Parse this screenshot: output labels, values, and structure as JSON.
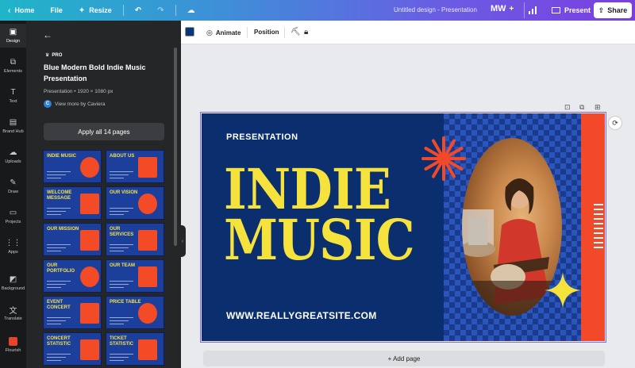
{
  "topbar": {
    "home": "Home",
    "file": "File",
    "resize": "Resize",
    "doc_title": "Untitled design - Presentation",
    "user_initials": "MW",
    "present": "Present",
    "share": "Share"
  },
  "rail": {
    "items": [
      {
        "label": "Design",
        "icon": "design-icon"
      },
      {
        "label": "Elements",
        "icon": "elements-icon"
      },
      {
        "label": "Text",
        "icon": "text-icon"
      },
      {
        "label": "Brand Hub",
        "icon": "brand-hub-icon"
      },
      {
        "label": "Uploads",
        "icon": "uploads-icon"
      },
      {
        "label": "Draw",
        "icon": "draw-icon"
      },
      {
        "label": "Projects",
        "icon": "projects-icon"
      },
      {
        "label": "Apps",
        "icon": "apps-icon"
      },
      {
        "label": "Background",
        "icon": "background-icon"
      },
      {
        "label": "Translate",
        "icon": "translate-icon"
      },
      {
        "label": "Flourish",
        "icon": "flourish-icon"
      }
    ]
  },
  "panel": {
    "badge": "PRO",
    "title": "Blue Modern Bold Indie Music Presentation",
    "meta": "Presentation • 1920 × 1080 px",
    "author": "View more by Caviera",
    "apply_button": "Apply all 14 pages",
    "thumbnails": [
      {
        "title": "INDIE MUSIC"
      },
      {
        "title": "ABOUT US"
      },
      {
        "title": "WELCOME MESSAGE"
      },
      {
        "title": "OUR VISION"
      },
      {
        "title": "OUR MISSION"
      },
      {
        "title": "OUR SERVICES"
      },
      {
        "title": "OUR PORTFOLIO"
      },
      {
        "title": "OUR TEAM"
      },
      {
        "title": "EVENT CONCERT"
      },
      {
        "title": "PRICE TABLE"
      },
      {
        "title": "CONCERT STATISTIC"
      },
      {
        "title": "TICKET STATISTIC"
      }
    ]
  },
  "canvas_toolbar": {
    "color": "#0b3778",
    "animate": "Animate",
    "position": "Position"
  },
  "slide": {
    "eyebrow": "PRESENTATION",
    "headline_line1": "INDIE",
    "headline_line2": "MUSIC",
    "url": "WWW.REALLYGREATSITE.COM",
    "colors": {
      "background": "#0b2f6e",
      "accent_yellow": "#f5e23c",
      "accent_red": "#f2492a"
    }
  },
  "add_page": "+ Add page"
}
